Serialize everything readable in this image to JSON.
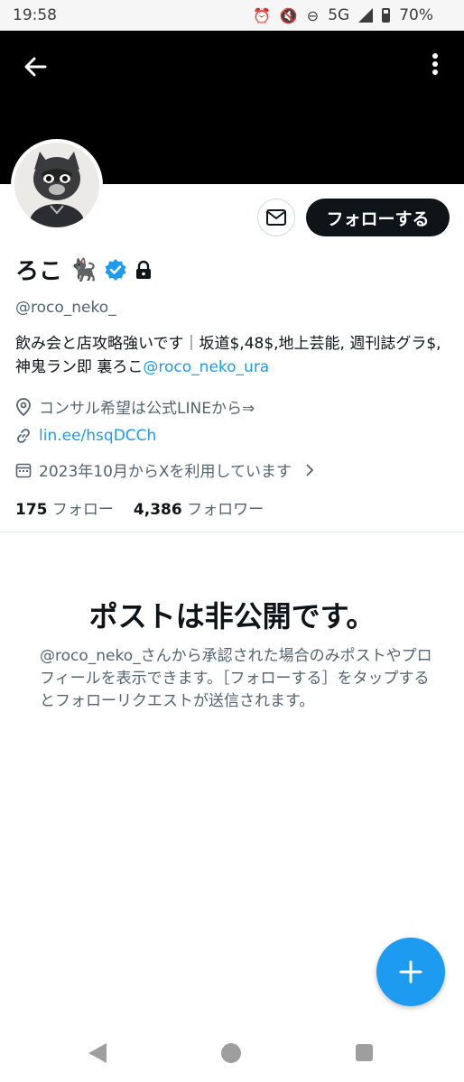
{
  "status_bar": {
    "time": "19:58",
    "network": "5G",
    "battery": "70%"
  },
  "profile": {
    "name": "ろこ",
    "name_emoji": "🐈‍⬛",
    "handle": "@roco_neko_",
    "verified": true,
    "protected": true,
    "bio_text": "飲み会と店攻略強いです｜坂道$,48$,地上芸能, 週刊誌グラ$,神鬼ラン即 裏ろこ",
    "bio_mention": "@roco_neko_ura",
    "location": "コンサル希望は公式LINEから⇒",
    "website": "lin.ee/hsqDCCh",
    "joined": "2023年10月からXを利用しています",
    "following_count": "175",
    "following_label": "フォロー",
    "followers_count": "4,386",
    "followers_label": "フォロワー"
  },
  "actions": {
    "follow_label": "フォローする"
  },
  "private_notice": {
    "title": "ポストは非公開です。",
    "body": "@roco_neko_さんから承認された場合のみポストやプロフィールを表示できます。［フォローする］をタップするとフォローリクエストが送信されます。"
  },
  "icons": [
    "back-arrow-icon",
    "more-vertical-icon",
    "mail-icon",
    "verified-badge-icon",
    "lock-icon",
    "location-icon",
    "link-icon",
    "calendar-icon",
    "plus-icon"
  ],
  "colors": {
    "accent": "#1d9bf0",
    "text": "#0f1419",
    "secondary": "#536471",
    "banner": "#000000"
  }
}
